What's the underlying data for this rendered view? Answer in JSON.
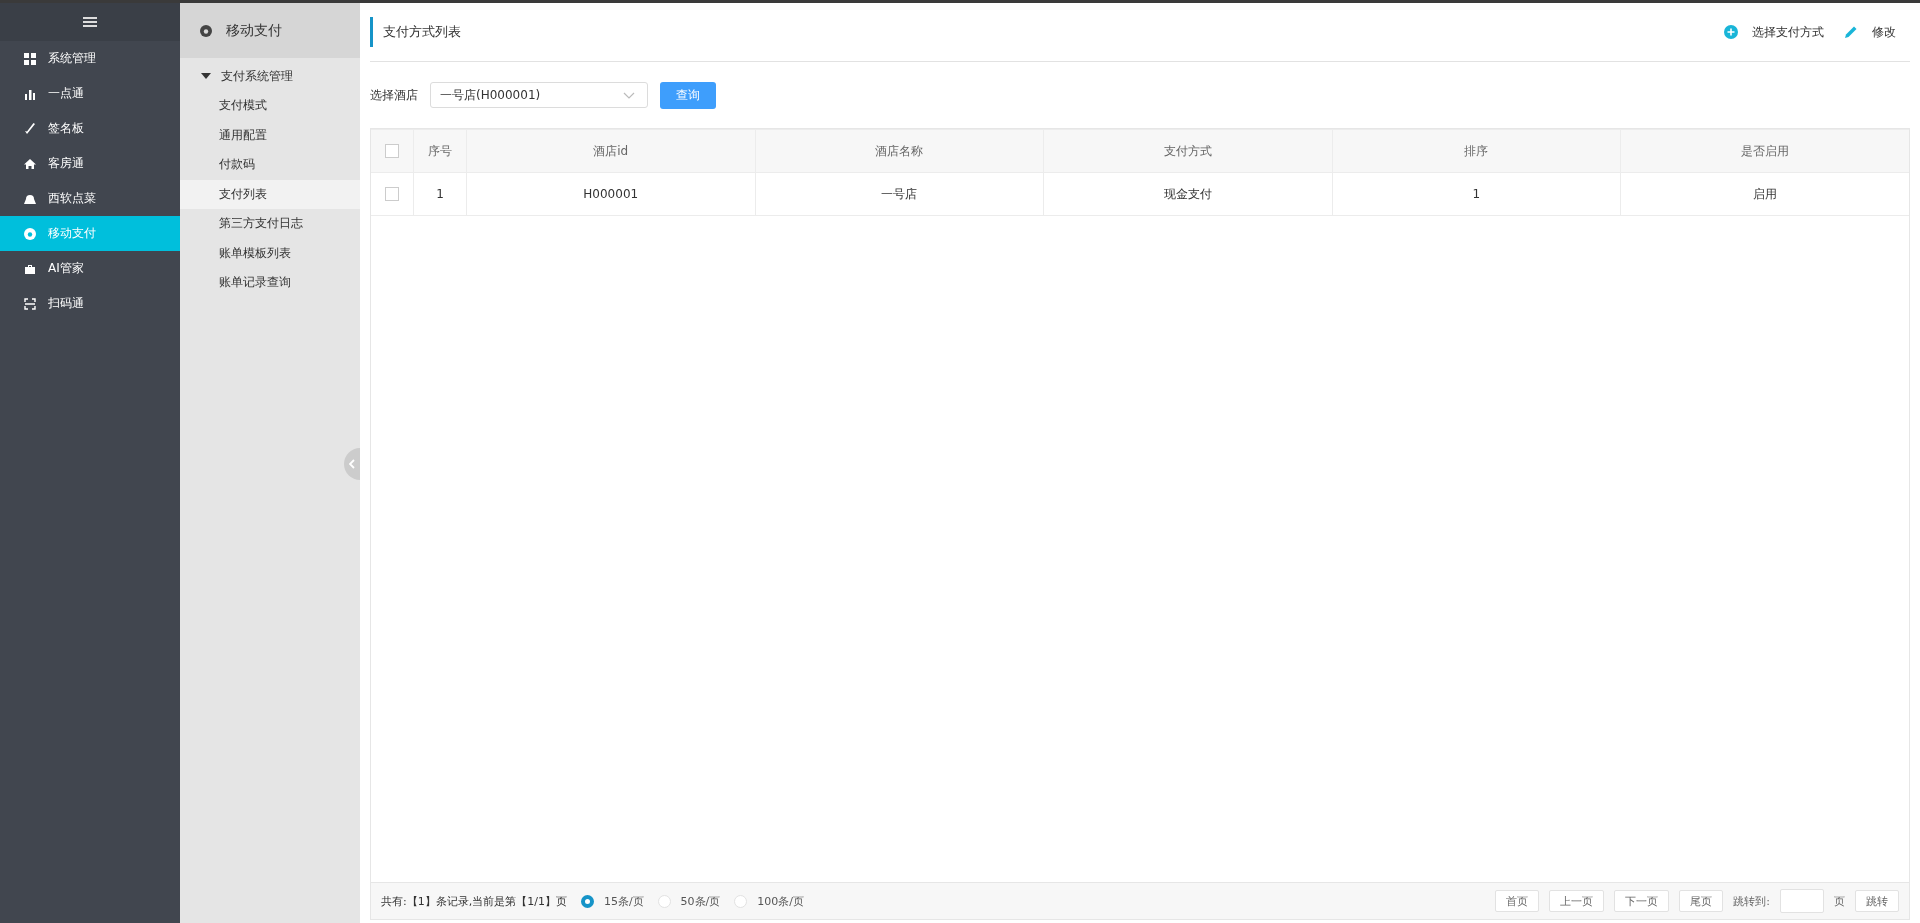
{
  "nav": {
    "items": [
      {
        "label": "系统管理",
        "kind": "grid",
        "selected": false
      },
      {
        "label": "一点通",
        "kind": "bars",
        "selected": false
      },
      {
        "label": "签名板",
        "kind": "pen",
        "selected": false
      },
      {
        "label": "客房通",
        "kind": "home",
        "selected": false
      },
      {
        "label": "西软点菜",
        "kind": "dome",
        "selected": false
      },
      {
        "label": "移动支付",
        "kind": "coin",
        "selected": true
      },
      {
        "label": "AI管家",
        "kind": "bag",
        "selected": false
      },
      {
        "label": "扫码通",
        "kind": "scan",
        "selected": false
      }
    ]
  },
  "submenu": {
    "title": "移动支付",
    "group": {
      "label": "支付系统管理",
      "expanded": true,
      "children": [
        {
          "label": "支付模式",
          "selected": false
        },
        {
          "label": "通用配置",
          "selected": false
        },
        {
          "label": "付款码",
          "selected": false
        },
        {
          "label": "支付列表",
          "selected": true
        },
        {
          "label": "第三方支付日志",
          "selected": false
        },
        {
          "label": "账单模板列表",
          "selected": false
        },
        {
          "label": "账单记录查询",
          "selected": false
        }
      ]
    }
  },
  "page": {
    "title": "支付方式列表",
    "actions": [
      {
        "label": "选择支付方式",
        "kind": "add"
      },
      {
        "label": "修改",
        "kind": "edit"
      }
    ]
  },
  "filter": {
    "label": "选择酒店",
    "value": "一号店(H000001)",
    "button": "查询"
  },
  "table": {
    "columns": [
      "序号",
      "酒店id",
      "酒店名称",
      "支付方式",
      "排序",
      "是否启用"
    ],
    "header_checked": false,
    "rows": [
      {
        "checked": false,
        "cells": [
          "1",
          "H000001",
          "一号店",
          "现金支付",
          "1",
          "启用"
        ]
      }
    ]
  },
  "footer": {
    "summary": "共有:【1】条记录,当前是第【1/1】页",
    "page_sizes": [
      {
        "label": "15条/页",
        "selected": true
      },
      {
        "label": "50条/页",
        "selected": false
      },
      {
        "label": "100条/页",
        "selected": false
      }
    ],
    "buttons": [
      "首页",
      "上一页",
      "下一页",
      "尾页"
    ],
    "jump_label": "跳转到:",
    "jump_unit": "页",
    "jump_button": "跳转"
  }
}
